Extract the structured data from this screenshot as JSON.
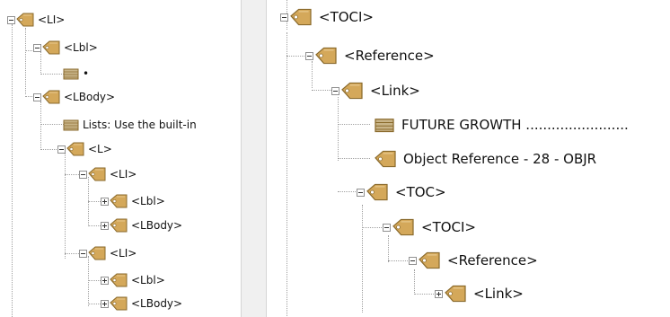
{
  "left_tree": {
    "nodes": [
      {
        "label": "<LI>",
        "type": "tag",
        "toggle": "minus"
      },
      {
        "label": "<Lbl>",
        "type": "tag",
        "toggle": "minus"
      },
      {
        "label": "•",
        "type": "content",
        "toggle": "none"
      },
      {
        "label": "<LBody>",
        "type": "tag",
        "toggle": "minus"
      },
      {
        "label": "Lists: Use the built-in",
        "type": "content",
        "toggle": "none"
      },
      {
        "label": "<L>",
        "type": "tag",
        "toggle": "minus"
      },
      {
        "label": "<LI>",
        "type": "tag",
        "toggle": "minus"
      },
      {
        "label": "<Lbl>",
        "type": "tag",
        "toggle": "plus"
      },
      {
        "label": "<LBody>",
        "type": "tag",
        "toggle": "plus"
      },
      {
        "label": "<LI>",
        "type": "tag",
        "toggle": "minus"
      },
      {
        "label": "<Lbl>",
        "type": "tag",
        "toggle": "plus"
      },
      {
        "label": "<LBody>",
        "type": "tag",
        "toggle": "plus"
      }
    ]
  },
  "right_tree": {
    "nodes": [
      {
        "label": "<TOCI>",
        "type": "tag",
        "toggle": "minus"
      },
      {
        "label": "<Reference>",
        "type": "tag",
        "toggle": "minus"
      },
      {
        "label": "<Link>",
        "type": "tag",
        "toggle": "minus"
      },
      {
        "label": "FUTURE GROWTH ........................",
        "type": "content",
        "toggle": "none"
      },
      {
        "label": "Object Reference - 28 - OBJR",
        "type": "tag",
        "toggle": "none"
      },
      {
        "label": "<TOC>",
        "type": "tag",
        "toggle": "minus"
      },
      {
        "label": "<TOCI>",
        "type": "tag",
        "toggle": "minus"
      },
      {
        "label": "<Reference>",
        "type": "tag",
        "toggle": "minus"
      },
      {
        "label": "<Link>",
        "type": "tag",
        "toggle": "plus"
      }
    ]
  },
  "colors": {
    "tag_fill": "#d4a85a",
    "tag_dark": "#8a6a2c",
    "box_fill": "#c8b488",
    "connector": "#a0a0a0",
    "panel_bg": "#ffffff",
    "gap_bg": "#f0f0f0"
  }
}
